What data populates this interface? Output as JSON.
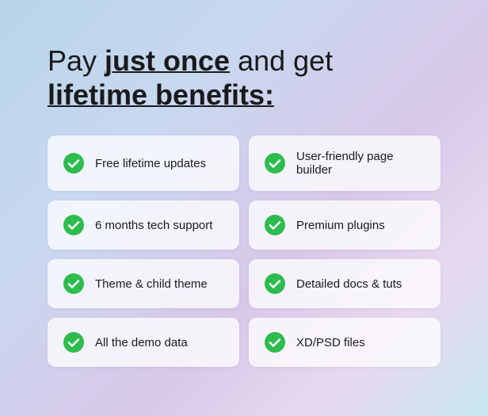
{
  "headline": {
    "line1_part1": "Pay ",
    "line1_bold": "just once",
    "line1_part2": " and get",
    "line2": "lifetime benefits:"
  },
  "benefits": [
    {
      "id": "free-updates",
      "text": "Free lifetime updates"
    },
    {
      "id": "page-builder",
      "text": "User-friendly page builder"
    },
    {
      "id": "tech-support",
      "text": "6 months tech support"
    },
    {
      "id": "premium-plugins",
      "text": "Premium plugins"
    },
    {
      "id": "child-theme",
      "text": "Theme & child theme"
    },
    {
      "id": "docs-tuts",
      "text": "Detailed docs & tuts"
    },
    {
      "id": "demo-data",
      "text": "All the demo data"
    },
    {
      "id": "xd-psd",
      "text": "XD/PSD files"
    }
  ],
  "colors": {
    "check_green": "#2ecc40"
  }
}
